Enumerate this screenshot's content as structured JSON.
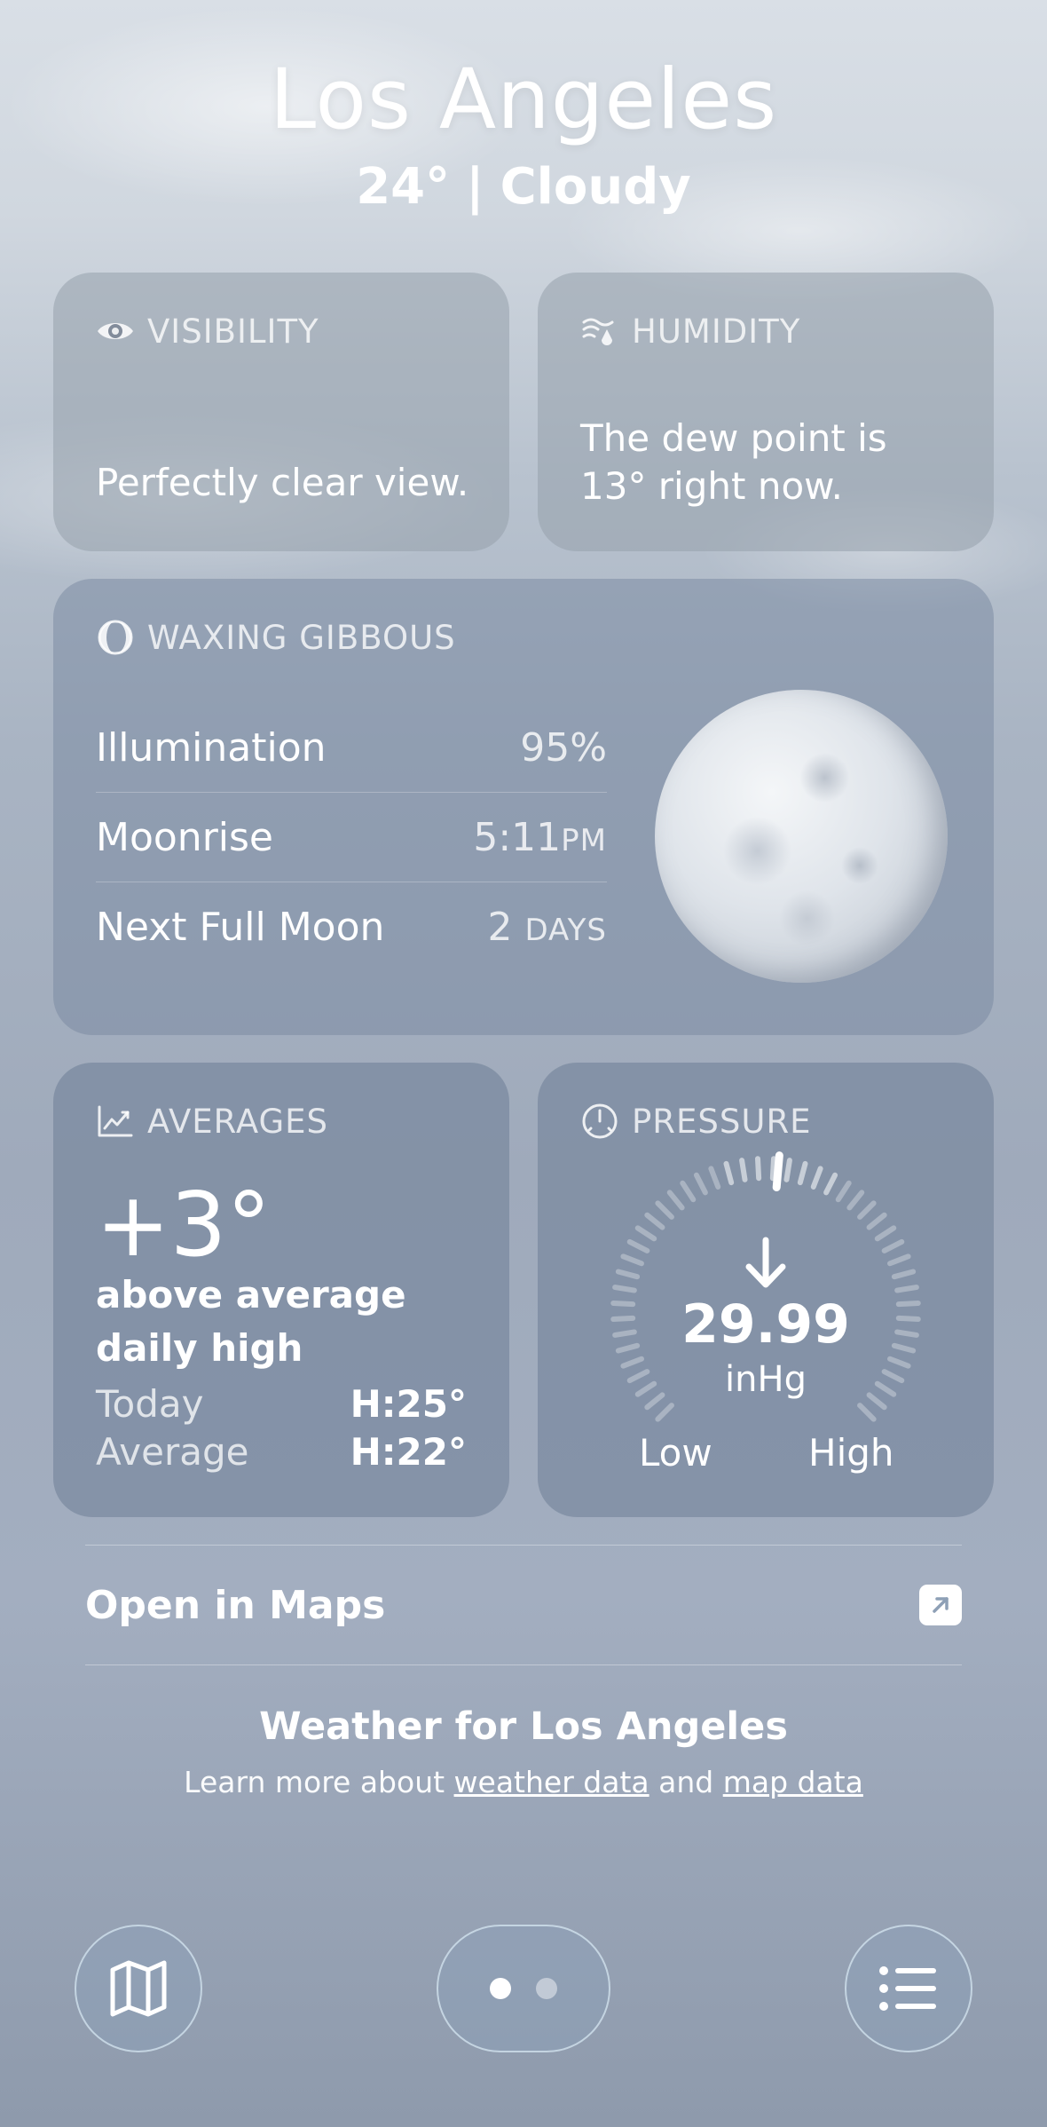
{
  "header": {
    "city": "Los Angeles",
    "temp": "24°",
    "separator": "|",
    "condition": "Cloudy"
  },
  "visibility": {
    "label": "VISIBILITY",
    "icon": "eye-icon",
    "text": "Perfectly clear view."
  },
  "humidity": {
    "label": "HUMIDITY",
    "icon": "humidity-icon",
    "text": "The dew point is 13° right now."
  },
  "moon": {
    "label": "WAXING GIBBOUS",
    "icon": "moon-phase-icon",
    "rows": [
      {
        "key": "Illumination",
        "value": "95%",
        "unit": ""
      },
      {
        "key": "Moonrise",
        "value": "5:11",
        "unit": "PM"
      },
      {
        "key": "Next Full Moon",
        "value": "2",
        "unit": "DAYS"
      }
    ]
  },
  "averages": {
    "label": "AVERAGES",
    "icon": "chart-trend-icon",
    "big": "+3°",
    "desc": "above average daily high",
    "rows": [
      {
        "key": "Today",
        "value": "H:25°"
      },
      {
        "key": "Average",
        "value": "H:22°"
      }
    ]
  },
  "pressure": {
    "label": "PRESSURE",
    "icon": "gauge-icon",
    "value": "29.99",
    "unit": "inHg",
    "trend": "falling",
    "low": "Low",
    "high": "High"
  },
  "maps": {
    "label": "Open in Maps"
  },
  "footer": {
    "title": "Weather for Los Angeles",
    "prefix": "Learn more about",
    "link1": "weather data",
    "mid": "and",
    "link2": "map data"
  },
  "toolbar": {
    "pages": 2,
    "active_page": 1
  }
}
